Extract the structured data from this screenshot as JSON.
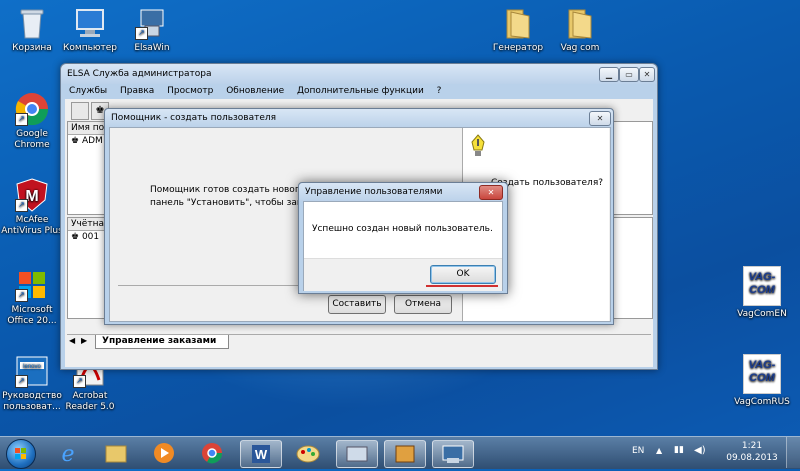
{
  "desktop": {
    "icons": [
      {
        "label": "Корзина"
      },
      {
        "label": "Компьютер"
      },
      {
        "label": "ElsaWin"
      },
      {
        "label": "Генератор"
      },
      {
        "label": "Vag com"
      },
      {
        "label": "Google Chrome"
      },
      {
        "label": "McAfee AntiVirus Plus"
      },
      {
        "label": "Microsoft Office 20..."
      },
      {
        "label": "Руководство пользоват..."
      },
      {
        "label": "Acrobat Reader 5.0"
      },
      {
        "label": "VagComEN"
      },
      {
        "label": "VagComRUS"
      }
    ],
    "vag_logo_text": [
      "VAG-",
      "COM"
    ]
  },
  "admin_window": {
    "title": "ELSA Служба администратора",
    "menu": [
      "Службы",
      "Правка",
      "Просмотр",
      "Обновление",
      "Дополнительные функции",
      "?"
    ],
    "list1_header": "Имя по",
    "list1_item": "ADM",
    "list2_header": "Учётная",
    "list2_item": "001",
    "tab_label": "Управление заказами"
  },
  "wizard": {
    "title": "Помощник - создать пользователя",
    "message_line1": "Помощник готов создать нового поль",
    "message_line2": "панель \"Установить\", чтобы закончит",
    "side_text": "Создать пользователя?",
    "compose_button": "Составить",
    "cancel_button": "Отмена"
  },
  "dialog": {
    "title": "Управление пользователями",
    "message": "Успешно создан новый пользователь.",
    "ok_button": "OK"
  },
  "taskbar": {
    "language": "EN",
    "time": "1:21",
    "date": "09.08.2013"
  },
  "colors": {
    "desktop": "#0b5cb0",
    "dialog_close": "#c9463d",
    "annotation_underline": "#d03030"
  }
}
